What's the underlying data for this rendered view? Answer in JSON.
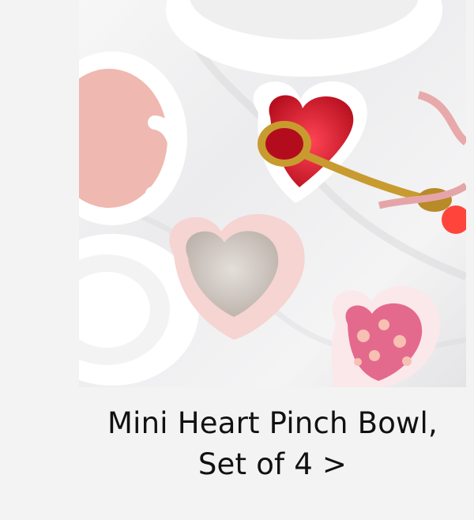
{
  "product": {
    "title_line_1": "Mini Heart Pinch Bowl,",
    "title_line_2": "Set of 4 >",
    "image_alt": "Heart-shaped pinch bowls filled with sprinkles on a marble countertop"
  },
  "colors": {
    "background": "#f3f3f3",
    "red_sprinkles": "#d91f2a",
    "pink_bowl": "#f4d6d4",
    "white_bowl": "#ffffff"
  }
}
